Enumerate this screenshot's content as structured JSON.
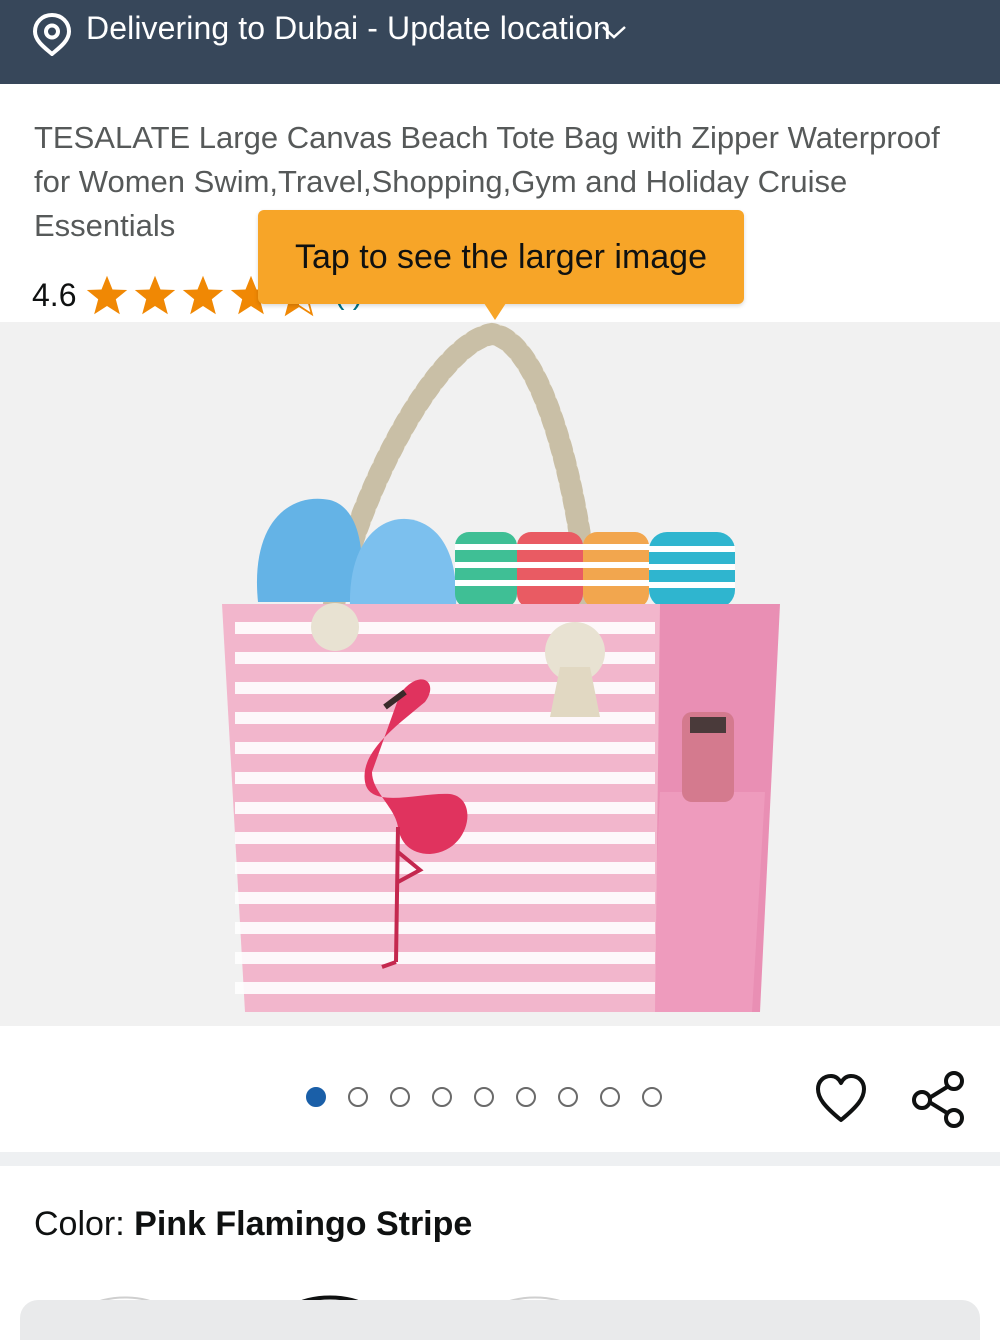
{
  "location_bar": {
    "icon": "location-pin-icon",
    "text": "Delivering to Dubai - Update location",
    "chevron_icon": "chevron-down-icon",
    "background": "#37475a"
  },
  "product": {
    "title": "TESALATE Large Canvas Beach Tote Bag with Zipper Waterproof for Women Swim,Travel,Shopping,Gym and Holiday Cruise Essentials",
    "rating": "4.6",
    "rating_stars": 4.5,
    "rating_count": "(     )"
  },
  "tooltip": {
    "text": "Tap to see the larger image",
    "color": "#f7a528"
  },
  "gallery": {
    "image_icon": "product-image",
    "image_count": 9,
    "active_index": 0,
    "active_color": "#1a5fa8"
  },
  "actions": {
    "wishlist_icon": "heart-icon",
    "share_icon": "share-icon"
  },
  "variant": {
    "label": "Color: ",
    "value": "Pink Flamingo Stripe"
  }
}
